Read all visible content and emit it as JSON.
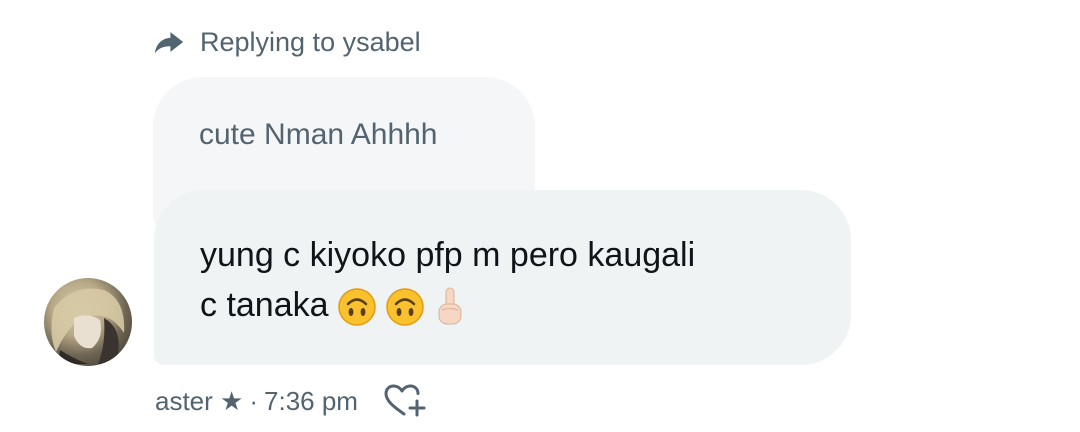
{
  "reply": {
    "text": "Replying to ysabel",
    "icon": "reply-arrow-icon"
  },
  "quoted_message": {
    "text": "cute Nman Ahhhh"
  },
  "message": {
    "line1": "yung c kiyoko pfp m pero kaugali",
    "line2": "c tanaka",
    "emojis": [
      "upside-down-face-emoji",
      "upside-down-face-emoji",
      "pointing-up-hand-emoji"
    ]
  },
  "meta": {
    "sender": "aster ★",
    "separator": "·",
    "time": "7:36 pm",
    "react_icon": "heart-plus-icon"
  },
  "colors": {
    "muted": "#536471",
    "text": "#0f1419",
    "bubble": "#eff3f4"
  }
}
